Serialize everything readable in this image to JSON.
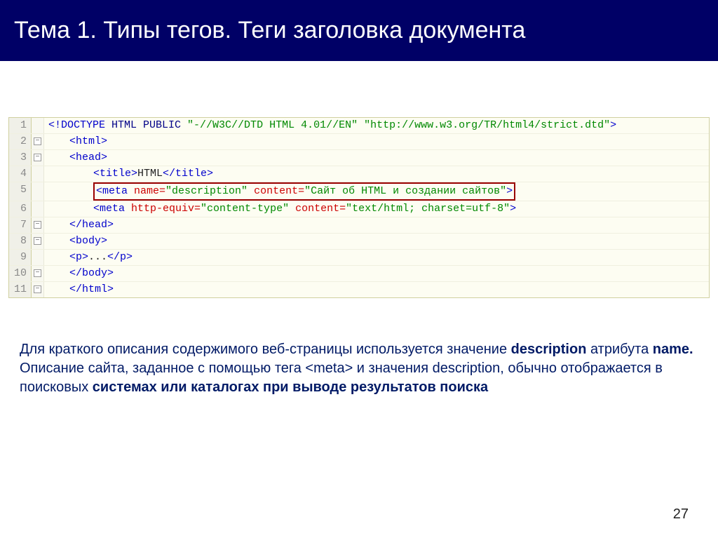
{
  "header": {
    "title": "Тема 1. Типы тегов. Теги заголовка документа"
  },
  "code": {
    "lines": [
      {
        "n": "1",
        "fold": "",
        "indent": 0,
        "tokens": [
          {
            "c": "tag",
            "t": "<!DOCTYPE "
          },
          {
            "c": "kw",
            "t": "HTML PUBLIC "
          },
          {
            "c": "val",
            "t": "\"-//W3C//DTD HTML 4.01//EN\" \"http://www.w3.org/TR/html4/strict.dtd\""
          },
          {
            "c": "tag",
            "t": ">"
          }
        ]
      },
      {
        "n": "2",
        "fold": "-",
        "indent": 1,
        "tokens": [
          {
            "c": "tag",
            "t": "<html>"
          }
        ]
      },
      {
        "n": "3",
        "fold": "-",
        "indent": 1,
        "tokens": [
          {
            "c": "tag",
            "t": "<head>"
          }
        ]
      },
      {
        "n": "4",
        "fold": "",
        "indent": 2,
        "tokens": [
          {
            "c": "tag",
            "t": "<title>"
          },
          {
            "c": "txt",
            "t": "HTML"
          },
          {
            "c": "tag",
            "t": "</title>"
          }
        ]
      },
      {
        "n": "5",
        "fold": "",
        "indent": 2,
        "highlight": true,
        "tokens": [
          {
            "c": "tag",
            "t": "<meta "
          },
          {
            "c": "attr",
            "t": "name="
          },
          {
            "c": "val",
            "t": "\"description\""
          },
          {
            "c": "attr",
            "t": " content="
          },
          {
            "c": "val",
            "t": "\"Сайт об HTML и создании сайтов\""
          },
          {
            "c": "tag",
            "t": ">"
          }
        ]
      },
      {
        "n": "6",
        "fold": "",
        "indent": 2,
        "tokens": [
          {
            "c": "tag",
            "t": "<meta "
          },
          {
            "c": "attr",
            "t": "http-equiv="
          },
          {
            "c": "val",
            "t": "\"content-type\""
          },
          {
            "c": "attr",
            "t": " content="
          },
          {
            "c": "val",
            "t": "\"text/html; charset=utf-8\""
          },
          {
            "c": "tag",
            "t": ">"
          }
        ]
      },
      {
        "n": "7",
        "fold": "-",
        "indent": 1,
        "tokens": [
          {
            "c": "tag",
            "t": "</head>"
          }
        ]
      },
      {
        "n": "8",
        "fold": "-",
        "indent": 1,
        "tokens": [
          {
            "c": "tag",
            "t": "<body>"
          }
        ]
      },
      {
        "n": "9",
        "fold": "",
        "indent": 1,
        "tokens": [
          {
            "c": "tag",
            "t": "<p>"
          },
          {
            "c": "txt",
            "t": "..."
          },
          {
            "c": "tag",
            "t": "</p>"
          }
        ]
      },
      {
        "n": "10",
        "fold": "-",
        "indent": 1,
        "tokens": [
          {
            "c": "tag",
            "t": "</body>"
          }
        ]
      },
      {
        "n": "11",
        "fold": "-",
        "indent": 1,
        "tokens": [
          {
            "c": "tag",
            "t": "</html>"
          }
        ]
      }
    ]
  },
  "paragraph": {
    "p1a": "Для краткого описания содержимого веб-страницы используется значение ",
    "p1b": "description",
    "p1c": " атрибута ",
    "p1d": "name.",
    "p1e": " Описание сайта, заданное с помощью тега <meta> и значения description, обычно отображается в поисковых ",
    "p1f": "системах или каталогах при выводе результатов поиска"
  },
  "page_number": "27"
}
